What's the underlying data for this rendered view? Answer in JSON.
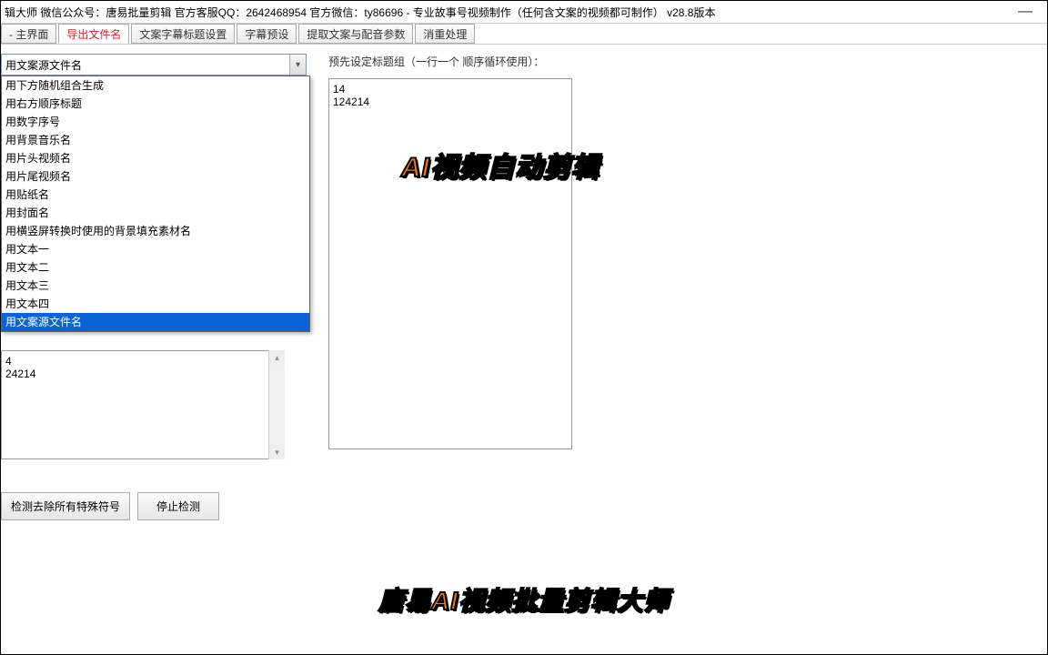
{
  "titlebar": {
    "text": "辑大师   微信公众号：唐易批量剪辑    官方客服QQ：2642468954   官方微信：ty86696  -  专业故事号视频制作（任何含文案的视频都可制作）   v28.8版本",
    "minimize": "—"
  },
  "tabs": {
    "items": [
      {
        "label": " - 主界面"
      },
      {
        "label": "导出文件名"
      },
      {
        "label": "文案字幕标题设置"
      },
      {
        "label": "字幕预设"
      },
      {
        "label": "提取文案与配音参数"
      },
      {
        "label": "消重处理"
      }
    ],
    "active_index": 1
  },
  "combo": {
    "value": "用文案源文件名",
    "options": [
      "用下方随机组合生成",
      "用右方顺序标题",
      "用数字序号",
      "用背景音乐名",
      "用片头视频名",
      "用片尾视频名",
      "用贴纸名",
      "用封面名",
      "用横竖屏转换时使用的背景填充素材名",
      "用文本一",
      "用文本二",
      "用文本三",
      "用文本四",
      "用文案源文件名"
    ],
    "selected_index": 13
  },
  "left_textarea": "4\n24214",
  "buttons": {
    "check": "检测去除所有特殊符号",
    "stop": "停止检测"
  },
  "right": {
    "label": "预先设定标题组（一行一个 顺序循环使用）：",
    "textarea": "14\n124214"
  },
  "overlay": {
    "line1": "AI视频自动剪辑",
    "line2": "唐易AI视频批量剪辑大师"
  }
}
